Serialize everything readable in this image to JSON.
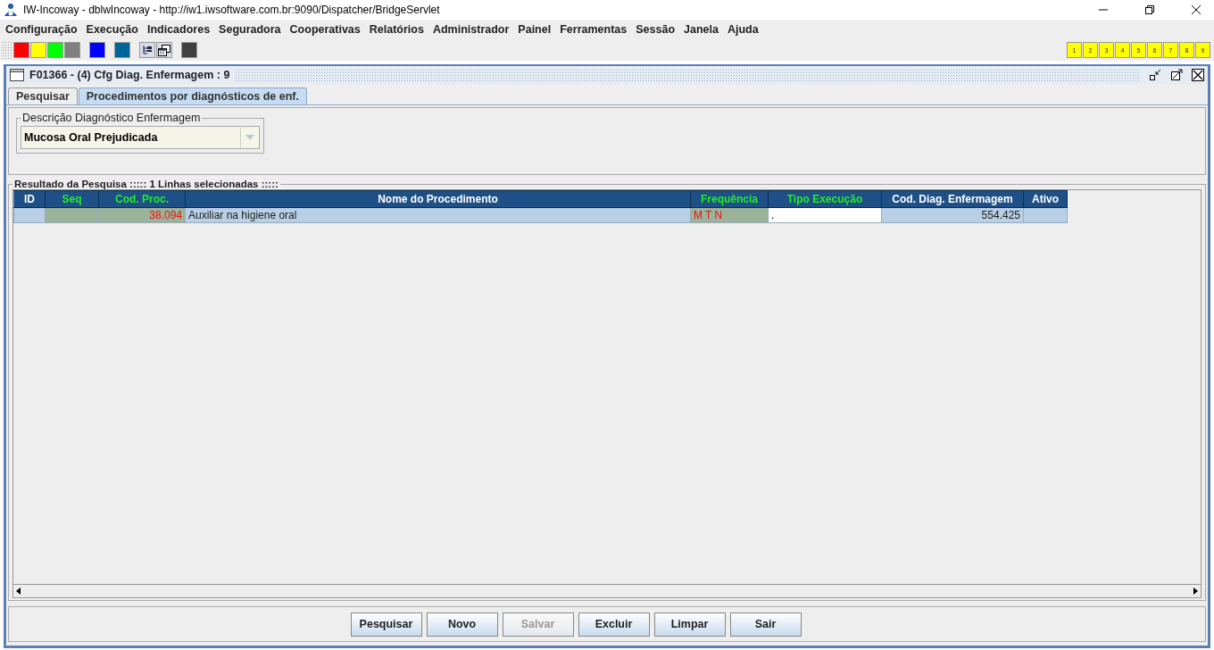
{
  "window": {
    "title": "IW-Incoway - dblwIncoway - http://iw1.iwsoftware.com.br:9090/Dispatcher/BridgeServlet"
  },
  "menu": [
    "Configuração",
    "Execução",
    "Indicadores",
    "Seguradora",
    "Cooperativas",
    "Relatórios",
    "Administrador",
    "Painel",
    "Ferramentas",
    "Sessão",
    "Janela",
    "Ajuda"
  ],
  "toolbar": {
    "swatches": [
      {
        "color": "#ff0000"
      },
      {
        "color": "#ffff00"
      },
      {
        "color": "#00ff00"
      },
      {
        "color": "#808080"
      },
      {
        "color": "#0000ff"
      },
      {
        "color": "#006699"
      },
      {
        "color": "#404040"
      }
    ],
    "numbers": [
      "1",
      "2",
      "3",
      "4",
      "5",
      "6",
      "7",
      "8",
      "9"
    ]
  },
  "frame": {
    "title": "F01366 - (4) Cfg Diag. Enfermagem : 9",
    "tabs": [
      {
        "label": "Pesquisar",
        "selected": false
      },
      {
        "label": "Procedimentos por diagnósticos de enf.",
        "selected": true
      }
    ],
    "diagnosis": {
      "legend": "Descrição Diagnóstico Enfermagem",
      "value": "Mucosa Oral Prejudicada"
    },
    "results": {
      "legend": "Resultado da Pesquisa ::::: 1 Linhas selecionadas :::::",
      "columns": [
        {
          "label": "ID",
          "kind": "plain"
        },
        {
          "label": "Seq",
          "kind": "editable"
        },
        {
          "label": "Cod. Proc.",
          "kind": "editable"
        },
        {
          "label": "Nome do Procedimento",
          "kind": "plain"
        },
        {
          "label": "Frequência",
          "kind": "editable"
        },
        {
          "label": "Tipo Execução",
          "kind": "editable"
        },
        {
          "label": "Cod. Diag. Enfermagem",
          "kind": "plain"
        },
        {
          "label": "Ativo",
          "kind": "plain"
        }
      ],
      "rows": [
        {
          "selected": true,
          "cells": [
            {
              "kind": "plain"
            },
            {
              "kind": "shaded"
            },
            {
              "kind": "shaded_number",
              "text": "38.094"
            },
            {
              "kind": "plain",
              "text": "Auxiliar na  higiene oral"
            },
            {
              "kind": "shaded",
              "text": "M T N"
            },
            {
              "kind": "input",
              "text": "."
            },
            {
              "kind": "number",
              "text": "554.425"
            },
            {
              "kind": "plain"
            }
          ]
        }
      ]
    },
    "buttons": [
      {
        "label": "Pesquisar",
        "disabled": false
      },
      {
        "label": "Novo",
        "disabled": false
      },
      {
        "label": "Salvar",
        "disabled": true
      },
      {
        "label": "Excluir",
        "disabled": false
      },
      {
        "label": "Limpar",
        "disabled": false
      },
      {
        "label": "Sair",
        "disabled": false
      }
    ]
  }
}
